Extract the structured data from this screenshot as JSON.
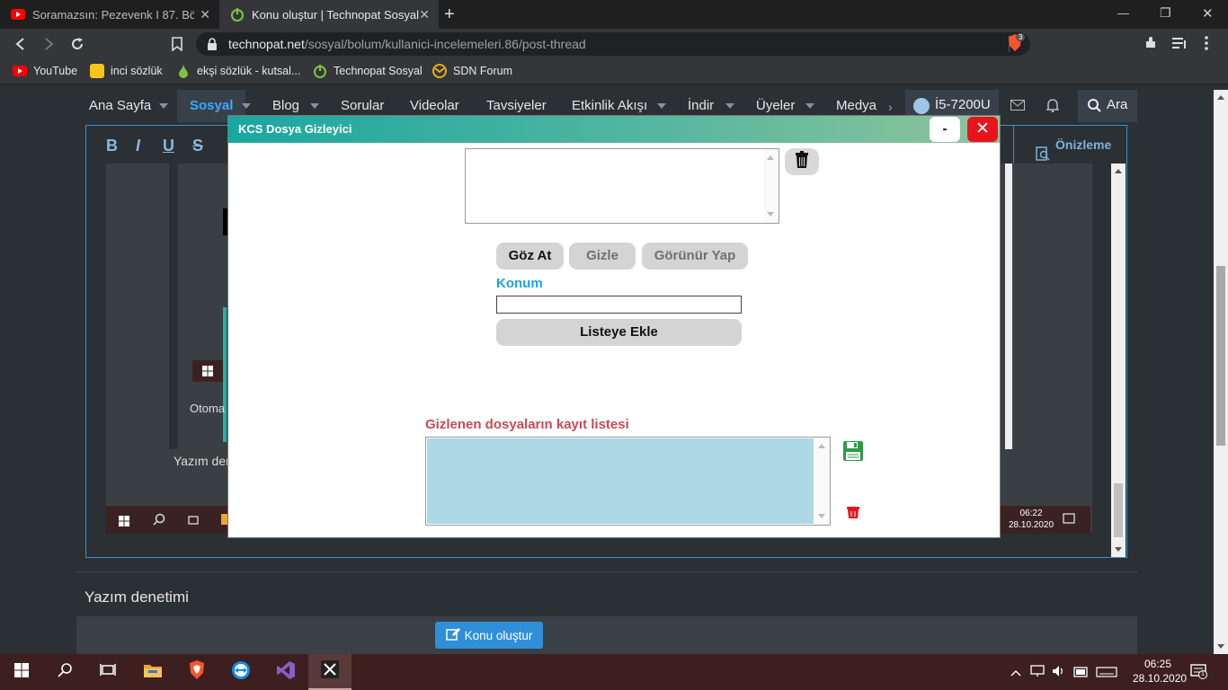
{
  "browser": {
    "tabs": [
      {
        "title": "Soramazsın: Pezevenk I 87. Bölüm",
        "active": false
      },
      {
        "title": "Konu oluştur | Technopat Sosyal",
        "active": true
      }
    ],
    "new_tab": "+",
    "url_host": "technopat.net",
    "url_path": "/sosyal/bolum/kullanici-incelemeleri.86/post-thread",
    "brave_count": "3",
    "bookmarks": [
      {
        "label": "YouTube",
        "icon": "youtube-icon",
        "color": "#ff0000"
      },
      {
        "label": "inci sözlük",
        "icon": "inci-icon",
        "color": "#f5c518"
      },
      {
        "label": "ekşi sözlük - kutsal...",
        "icon": "eksi-icon",
        "color": "#81c14b"
      },
      {
        "label": "Technopat Sosyal",
        "icon": "power-icon",
        "color": "#7fc241"
      },
      {
        "label": "SDN Forum",
        "icon": "sdn-icon",
        "color": "#e0b020"
      }
    ],
    "window_controls": {
      "minimize": "—",
      "maximize": "❐",
      "close": "✕"
    }
  },
  "site_nav": {
    "items": [
      "Ana Sayfa",
      "Sosyal",
      "Blog",
      "Sorular",
      "Videolar",
      "Tavsiyeler",
      "Etkinlik Akışı",
      "İndir",
      "Üyeler",
      "Medya"
    ],
    "active": "Sosyal",
    "user": "İ5-7200U",
    "search": "Ara"
  },
  "editor": {
    "toolbar": [
      "B",
      "I",
      "U",
      "S"
    ],
    "preview": "Önizleme",
    "behind_texts": {
      "otoma": "Otoma",
      "yazim_den": "Yazım den",
      "inner_time": "06:22",
      "inner_date": "28.10.2020"
    }
  },
  "page": {
    "yazim_denetimi": "Yazım denetimi",
    "submit": "Konu oluştur"
  },
  "dialog": {
    "title": "KCS Dosya Gizleyici",
    "minimize": "-",
    "close": "✕",
    "buttons": {
      "browse": "Göz At",
      "hide": "Gizle",
      "show": "Görünür Yap",
      "add": "Listeye Ekle"
    },
    "konum_label": "Konum",
    "konum_value": "",
    "list_label": "Gizlenen dosyaların kayıt listesi",
    "colors": {
      "accent_blue": "#1aa6e8",
      "accent_red": "#c94a55",
      "list_bg": "#add8e6"
    }
  },
  "taskbar": {
    "time": "06:25",
    "date": "28.10.2020",
    "notification_count": "1"
  }
}
